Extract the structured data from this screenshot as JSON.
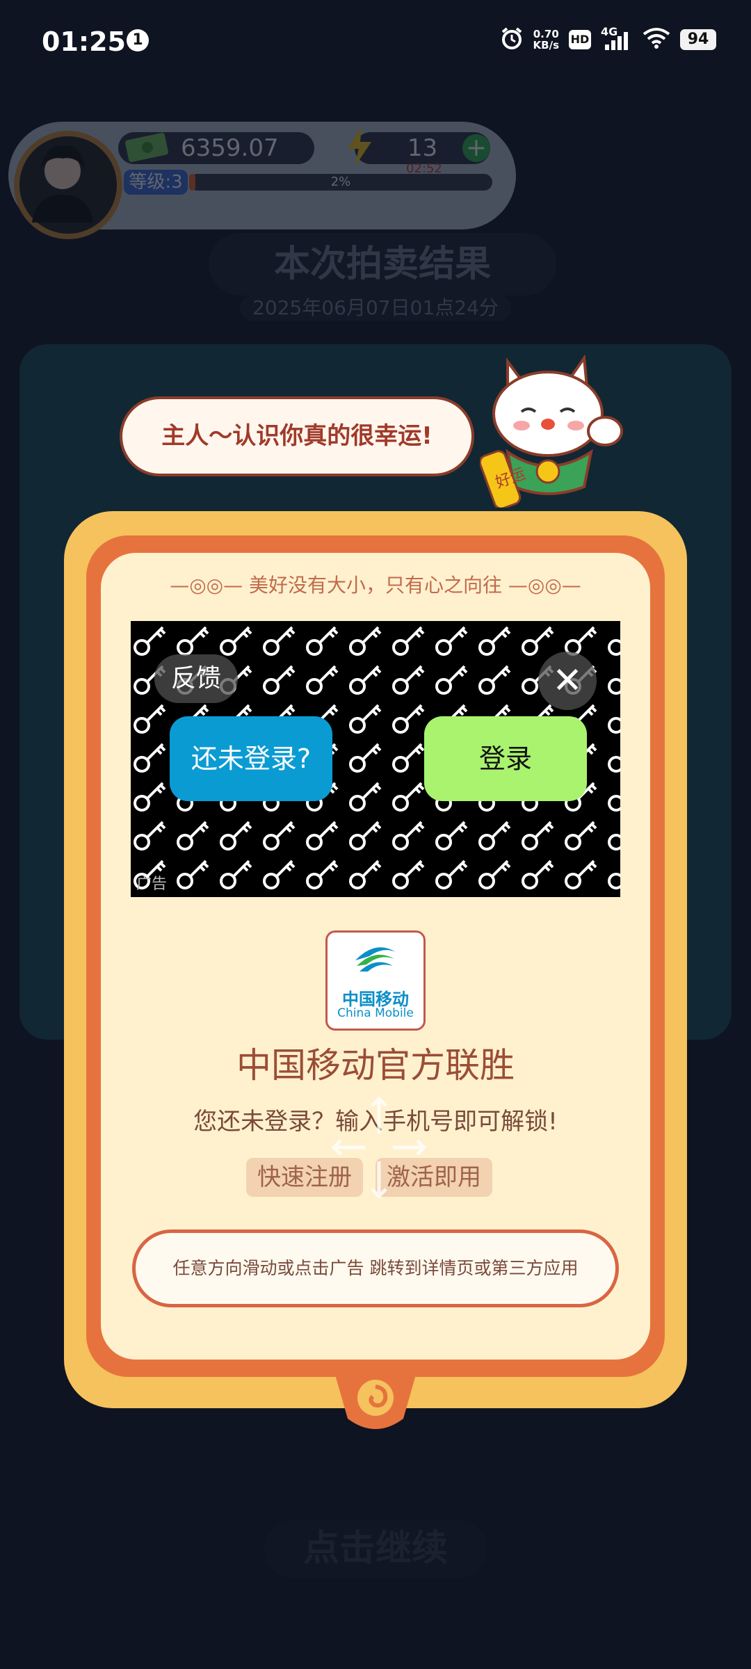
{
  "status_bar": {
    "time": "01:25",
    "notification_badge": "1",
    "net_speed_value": "0.70",
    "net_speed_unit": "KB/s",
    "hd_label": "HD",
    "signal_label": "4G",
    "battery": "94"
  },
  "profile": {
    "money": "6359.07",
    "energy": "13",
    "energy_timer": "02:52",
    "level_label": "等级:3",
    "progress_label": "2%",
    "progress_fraction": 0.02
  },
  "background": {
    "title": "本次拍卖结果",
    "date": "2025年06月07日01点24分",
    "continue_label": "点击继续"
  },
  "cat": {
    "speech": "主人～认识你真的很幸运!",
    "charm_text": "好运"
  },
  "card": {
    "tagline": "美好没有大小，只有心之向往",
    "ad": {
      "feedback_label": "反馈",
      "not_logged_label": "还未登录?",
      "login_label": "登录",
      "ad_label": "广告"
    },
    "logo": {
      "cn": "中国移动",
      "en": "China Mobile"
    },
    "brand_title": "中国移动官方联胜",
    "description": "您还未登录？输入手机号即可解锁!",
    "tags": [
      "快速注册",
      "激活即用"
    ],
    "cta": "任意方向滑动或点击广告 跳转到详情页或第三方应用"
  },
  "colors": {
    "card_outer": "#f5c25d",
    "card_mid": "#e6733e",
    "card_inner": "#fff1ce",
    "ad_blue": "#0b9bd3",
    "ad_green": "#a9f36e"
  }
}
